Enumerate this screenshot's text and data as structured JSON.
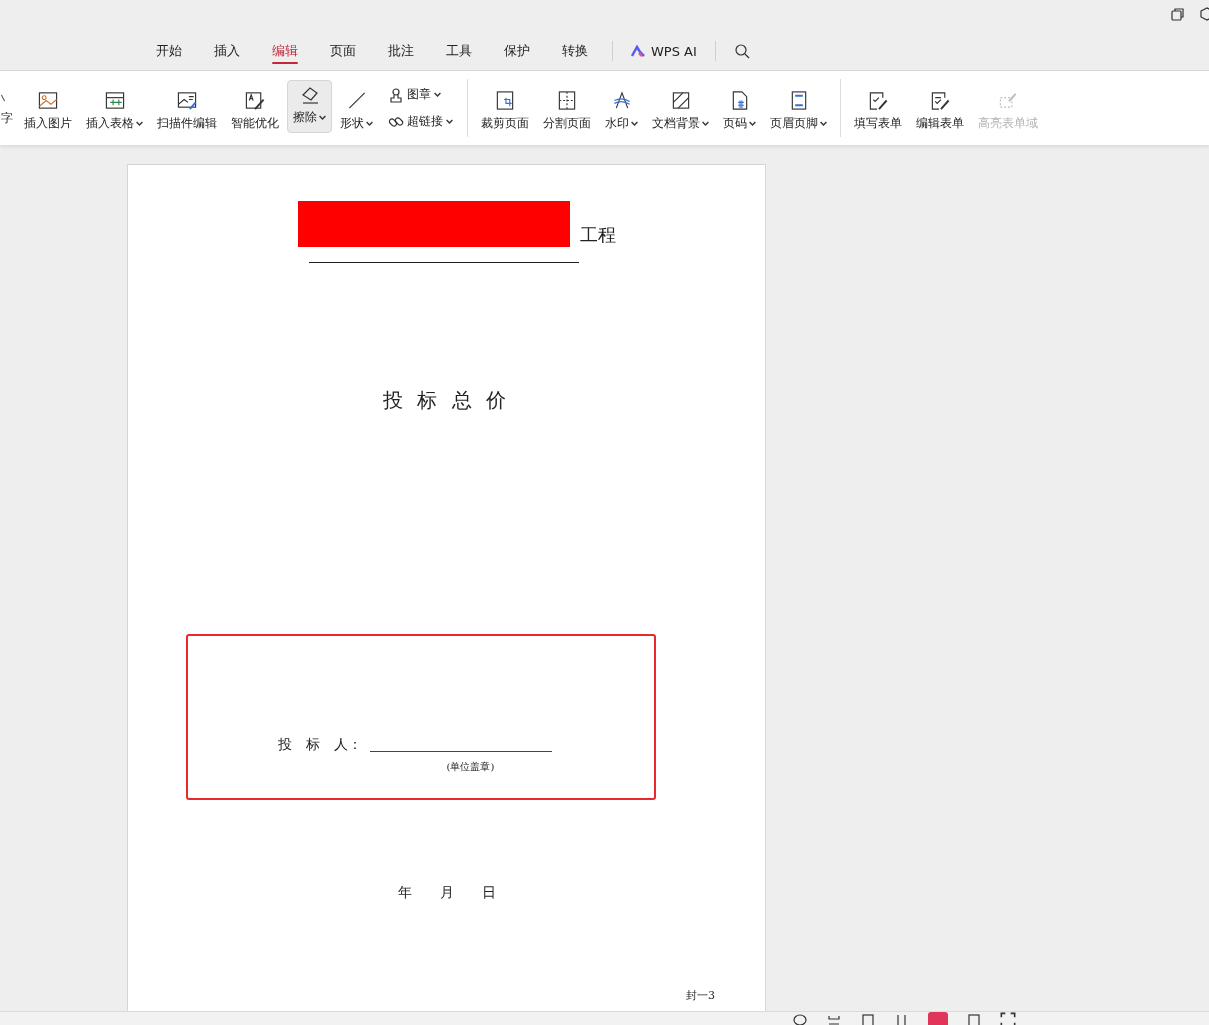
{
  "tabs": [
    {
      "label": "开始",
      "selected": false
    },
    {
      "label": "插入",
      "selected": false
    },
    {
      "label": "编辑",
      "selected": true
    },
    {
      "label": "页面",
      "selected": false
    },
    {
      "label": "批注",
      "selected": false
    },
    {
      "label": "工具",
      "selected": false
    },
    {
      "label": "保护",
      "selected": false
    },
    {
      "label": "转换",
      "selected": false
    }
  ],
  "ai_tab": {
    "label": "WPS AI"
  },
  "ribbon": [
    {
      "kind": "large",
      "label": "字",
      "dropdown": false,
      "selected": false,
      "disabled": false
    },
    {
      "kind": "large",
      "label": "插入图片",
      "dropdown": false,
      "selected": false,
      "disabled": false
    },
    {
      "kind": "large",
      "label": "插入表格",
      "dropdown": true,
      "selected": false,
      "disabled": false
    },
    {
      "kind": "large",
      "label": "扫描件编辑",
      "dropdown": false,
      "selected": false,
      "disabled": false
    },
    {
      "kind": "large",
      "label": "智能优化",
      "dropdown": false,
      "selected": false,
      "disabled": false
    },
    {
      "kind": "large",
      "label": "擦除",
      "dropdown": true,
      "selected": true,
      "disabled": false
    },
    {
      "kind": "large",
      "label": "形状",
      "dropdown": true,
      "selected": false,
      "disabled": false
    },
    {
      "kind": "stack",
      "items": [
        {
          "label": "图章",
          "dropdown": true
        },
        {
          "label": "超链接",
          "dropdown": true
        }
      ]
    },
    {
      "kind": "separator"
    },
    {
      "kind": "large",
      "label": "裁剪页面",
      "dropdown": false,
      "selected": false,
      "disabled": false
    },
    {
      "kind": "large",
      "label": "分割页面",
      "dropdown": false,
      "selected": false,
      "disabled": false
    },
    {
      "kind": "large",
      "label": "水印",
      "dropdown": true,
      "selected": false,
      "disabled": false
    },
    {
      "kind": "large",
      "label": "文档背景",
      "dropdown": true,
      "selected": false,
      "disabled": false
    },
    {
      "kind": "large",
      "label": "页码",
      "dropdown": true,
      "selected": false,
      "disabled": false
    },
    {
      "kind": "large",
      "label": "页眉页脚",
      "dropdown": true,
      "selected": false,
      "disabled": false
    },
    {
      "kind": "separator"
    },
    {
      "kind": "large",
      "label": "填写表单",
      "dropdown": false,
      "selected": false,
      "disabled": false
    },
    {
      "kind": "large",
      "label": "编辑表单",
      "dropdown": false,
      "selected": false,
      "disabled": false
    },
    {
      "kind": "large",
      "label": "高亮表单域",
      "dropdown": false,
      "selected": false,
      "disabled": true
    }
  ],
  "document": {
    "project_suffix": "工程",
    "title": "投 标 总 价",
    "bidder_label": "投　标　人：",
    "seal_note": "(单位盖章)",
    "date": "年　　月　　日",
    "page_label": "封一3"
  }
}
